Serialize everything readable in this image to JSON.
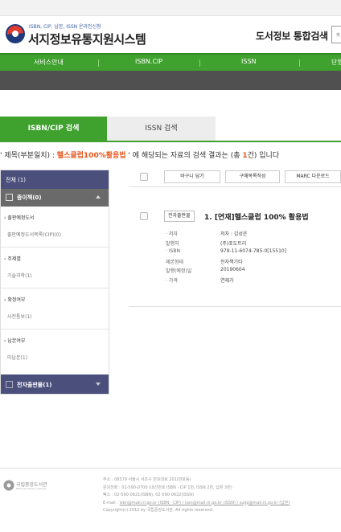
{
  "header": {
    "brand_small": "ISBN, CIP, 납본, ISSN 온라인신청",
    "brand_title": "서지정보유통지원시스템",
    "unified_search": "도서정보 통합검색",
    "search_placeholder": "제"
  },
  "nav": {
    "items": [
      "서비스안내",
      "ISBN.CIP",
      "ISSN",
      "단행"
    ]
  },
  "tabs": {
    "isbn": "ISBN/CIP 검색",
    "issn": "ISSN 검색"
  },
  "result_summary": {
    "prefix": "' 제목(부분일치) : ",
    "keyword": "헬스클럽100%활용법",
    "middle": " ' 에 해당되는 자료의 검색 결과는 (총 ",
    "count": "1",
    "suffix": "건) 입니다"
  },
  "sidebar": {
    "all": "전체 (1)",
    "media": "종이책(0)",
    "groups": [
      {
        "head": "출판예정도서",
        "sub": "출판예정도서목록(CIP)(0)"
      },
      {
        "head": "주제별",
        "sub": "기술과학(1)"
      },
      {
        "head": "확정여부",
        "sub": "사전통보(1)"
      },
      {
        "head": "납본여부",
        "sub": "미납본(1)"
      }
    ],
    "ebook": "전자출판물(1)"
  },
  "toolbar": {
    "cart": "바구니 담기",
    "purchase": "구매목록작성",
    "marc": "MARC 다운로드"
  },
  "result": {
    "badge": "전자출판물",
    "title": "1. [연재]헬스클럽 100% 활용법",
    "meta": [
      {
        "label": "· 저자",
        "value": "저자 : 김성운"
      },
      {
        "label": "발행처",
        "value": "(주)포도트리"
      },
      {
        "label": "· ISBN",
        "value": "979-11-6074-785-0[15510]"
      },
      {
        "label": "제본형태",
        "value": "전자책기타"
      },
      {
        "label": "발행(예정)일",
        "value": "20190604"
      },
      {
        "label": "· 가격",
        "value": "연재가"
      }
    ]
  },
  "footer": {
    "org_name": "국립중앙도서관",
    "org_name_en": "National Library of Korea",
    "address": "주소 : 06579 서울시 서초구 반포대로 201(반포동)",
    "phone": "문의전화 : 02-590-0700 (내선번호 ISBN · CIP 1번, ISSN 2번, 납본 3번)",
    "fax": "팩스 : 02-590-0621(ISBN), 02-590-0622(ISSN)",
    "email_prefix": "E-mail : ",
    "email": "isbn@mail.nl.go.kr (ISBN · CIP) / issn@mail.nl.go.kr (ISSN) / sujip@mail.nl.go.kr (납본)",
    "copyright": "Copyright(c) 2012 by 국립중앙도서관. All rights reserved."
  },
  "colors": {
    "accent_green": "#3fa12e",
    "keyword_orange": "#e8551c",
    "sidebar_navy": "#4a4f7c"
  }
}
